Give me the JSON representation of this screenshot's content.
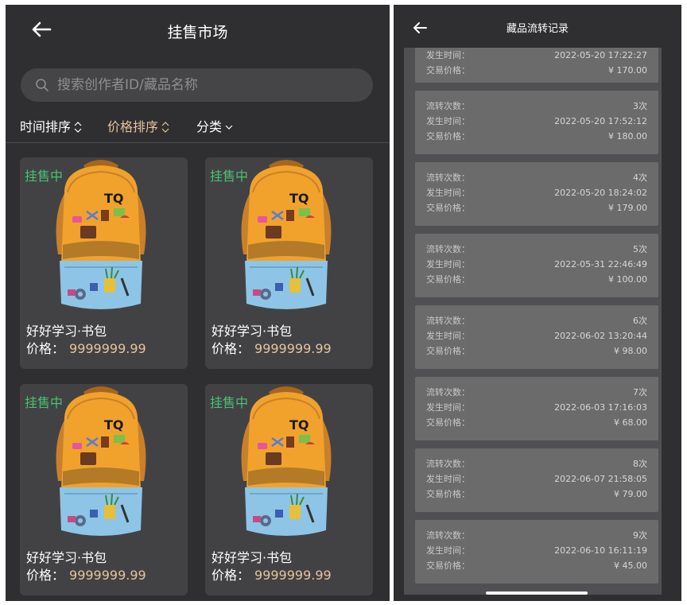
{
  "market": {
    "title": "挂售市场",
    "search": {
      "placeholder": "搜索创作者ID/藏品名称",
      "value": ""
    },
    "filters": {
      "time_sort": "时间排序",
      "price_sort": "价格排序",
      "category": "分类"
    },
    "items": [
      {
        "status": "挂售中",
        "name": "好好学习·书包",
        "price_label": "价格：",
        "price": "9999999.99"
      },
      {
        "status": "挂售中",
        "name": "好好学习·书包",
        "price_label": "价格：",
        "price": "9999999.99"
      },
      {
        "status": "挂售中",
        "name": "好好学习·书包",
        "price_label": "价格：",
        "price": "9999999.99"
      },
      {
        "status": "挂售中",
        "name": "好好学习·书包",
        "price_label": "价格：",
        "price": "9999999.99"
      }
    ],
    "brand_text": "TQ",
    "icons": {
      "back": "back-arrow-icon",
      "search": "search-icon",
      "sort": "sort-updown-icon",
      "dropdown": "chevron-down-icon"
    },
    "colors": {
      "background": "#2f2f31",
      "card": "#424245",
      "accent": "#e3c49b",
      "status": "#49c270"
    }
  },
  "record": {
    "title": "藏品流转记录",
    "labels": {
      "count": "流转次数：",
      "time": "发生时间：",
      "price": "交易价格："
    },
    "partial": {
      "time": "2022-05-20 17:22:27",
      "price": "¥ 170.00"
    },
    "entries": [
      {
        "count": "3次",
        "time": "2022-05-20 17:52:12",
        "price": "¥ 180.00"
      },
      {
        "count": "4次",
        "time": "2022-05-20 18:24:02",
        "price": "¥ 179.00"
      },
      {
        "count": "5次",
        "time": "2022-05-31 22:46:49",
        "price": "¥ 100.00"
      },
      {
        "count": "6次",
        "time": "2022-06-02 13:20:44",
        "price": "¥ 98.00"
      },
      {
        "count": "7次",
        "time": "2022-06-03 17:16:03",
        "price": "¥ 68.00"
      },
      {
        "count": "8次",
        "time": "2022-06-07 21:58:05",
        "price": "¥ 79.00"
      },
      {
        "count": "9次",
        "time": "2022-06-10 16:11:19",
        "price": "¥ 45.00"
      }
    ],
    "colors": {
      "panel": "#505052",
      "record": "#6b6b6c"
    }
  }
}
